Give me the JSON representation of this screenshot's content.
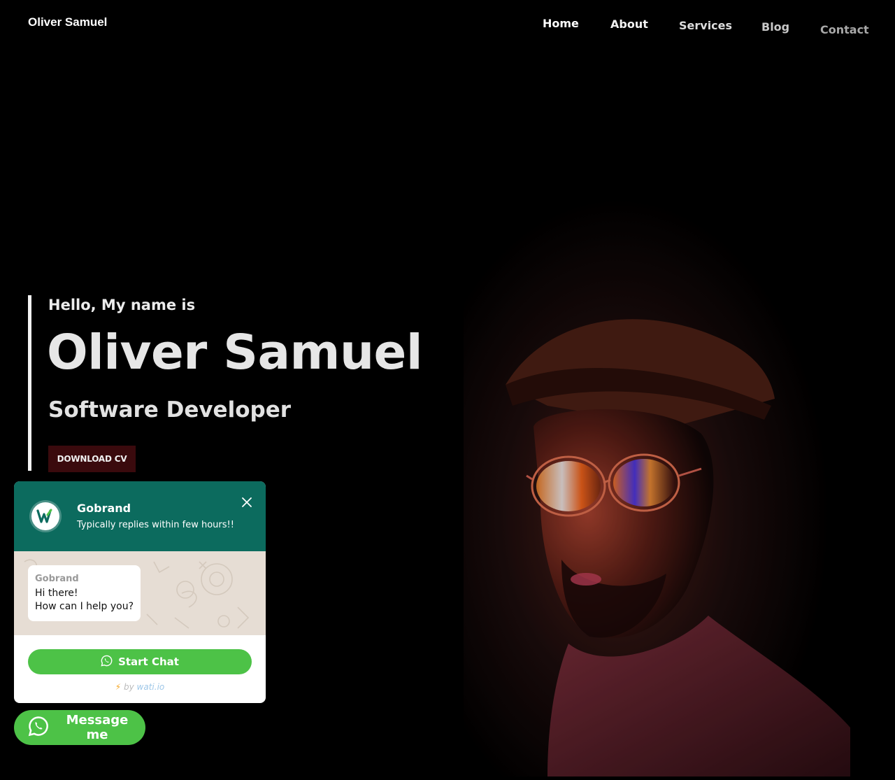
{
  "brand": "Oliver Samuel",
  "nav": [
    "Home",
    "About",
    "Services",
    "Blog",
    "Contact"
  ],
  "hero": {
    "greeting": "Hello, My name is",
    "name": "Oliver Samuel",
    "role": "Software Developer",
    "cta": "DOWNLOAD CV"
  },
  "chat_widget": {
    "title": "Gobrand",
    "subtitle": "Typically replies within few hours!!",
    "close_icon": "close-icon",
    "bubble": {
      "sender": "Gobrand",
      "line1": "Hi there!",
      "line2": "How can I help you?"
    },
    "start_label": "Start Chat",
    "powered_bolt": "⚡",
    "powered_by": "by",
    "powered_brand": "wati.io"
  },
  "message_button": "Message me",
  "colors": {
    "background": "#000000",
    "widget_header": "#0c6b5e",
    "whatsapp_green": "#4dc247",
    "download_button": "#3a0a0d"
  }
}
